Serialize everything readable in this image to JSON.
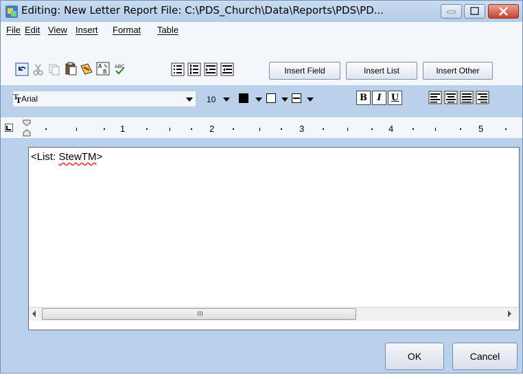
{
  "window": {
    "title": "Editing: New Letter Report   File: C:\\PDS_Church\\Data\\Reports\\PDS\\PD..."
  },
  "menu": [
    "File",
    "Edit",
    "View",
    "Insert",
    "Format",
    "Table"
  ],
  "toolbar": {
    "insert_field": "Insert Field",
    "insert_list": "Insert List",
    "insert_other": "Insert Other"
  },
  "format_bar": {
    "font_name": "Arial",
    "font_size": "10",
    "bold": "B",
    "italic": "I",
    "underline": "U"
  },
  "ruler": {
    "labels": [
      "1",
      "2",
      "3",
      "4",
      "5"
    ]
  },
  "editor": {
    "prefix": "<List: ",
    "field": "StewTM",
    "suffix": ">"
  },
  "scrollbar": {
    "grip": "III"
  },
  "buttons": {
    "ok": "OK",
    "cancel": "Cancel"
  },
  "colors": {
    "titlebar": "#c3d7ee",
    "close": "#c7452d",
    "text_color_swatch": "#000000"
  }
}
